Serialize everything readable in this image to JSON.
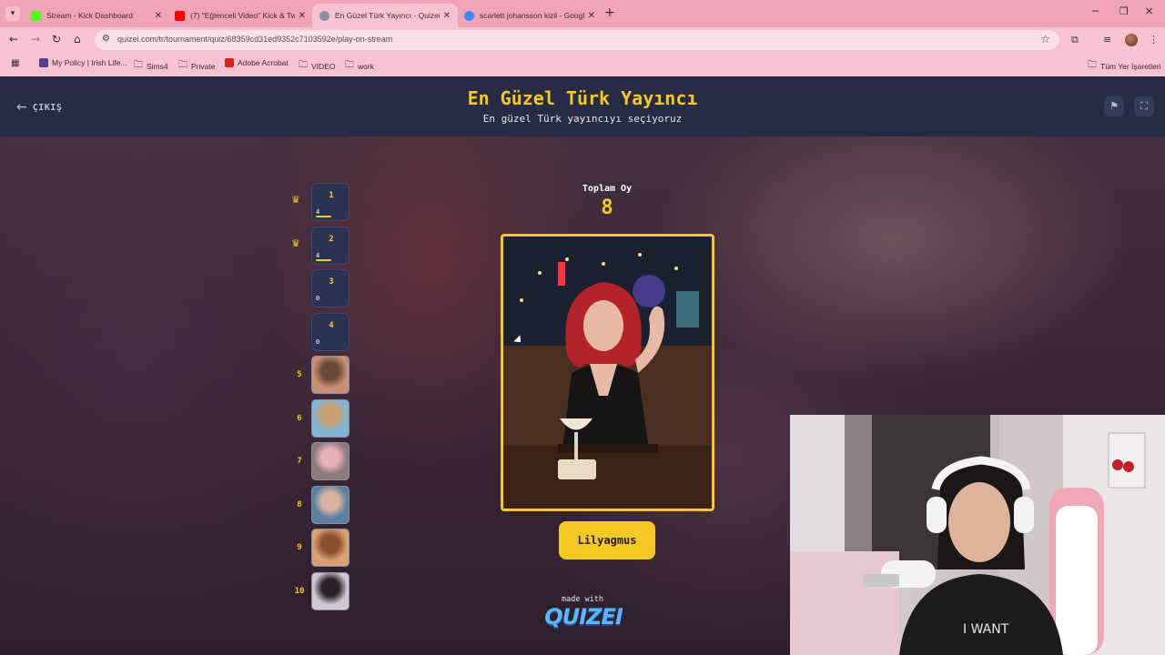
{
  "browser": {
    "tabs": [
      {
        "title": "Stream - Kick Dashboard",
        "favicon_color": "#53fc18"
      },
      {
        "title": "(7) \"Eğlenceli Video\" Kick & Tw",
        "favicon_color": "#ff0000"
      },
      {
        "title": "En Güzel Türk Yayıncı - Quizei",
        "favicon_color": "#8a8fa8"
      },
      {
        "title": "scarlett johansson kizil - Googl",
        "favicon_color": "#4285f4"
      }
    ],
    "active_tab": 2,
    "address": "quizei.com/tr/tournament/quiz/68359cd31ed9352c7103592e/play-on-stream",
    "bookmarks": [
      {
        "label": "My Policy | Irish Life...",
        "icon": "policy-icon"
      },
      {
        "label": "Sims4",
        "icon": "folder-icon"
      },
      {
        "label": "Private",
        "icon": "folder-icon"
      },
      {
        "label": "Adobe Acrobat",
        "icon": "acrobat-icon"
      },
      {
        "label": "VIDEO",
        "icon": "folder-icon"
      },
      {
        "label": "work",
        "icon": "folder-icon"
      }
    ],
    "all_bookmarks": "Tüm Yer İşaretleri"
  },
  "quiz": {
    "exit_label": "ÇIKIŞ",
    "title": "En Güzel Türk Yayıncı",
    "subtitle": "En güzel Türk yayıncıyı seçiyoruz",
    "total_votes_label": "Toplam Oy",
    "total_votes": "8",
    "current_name": "Lilyagmus",
    "made_with": "made with",
    "brand": "QUIZEI",
    "accent_color": "#f5c924"
  },
  "ranking": [
    {
      "rank": "1",
      "votes": "4",
      "share": 0.5,
      "crown": true,
      "revealed": false
    },
    {
      "rank": "2",
      "votes": "4",
      "share": 0.5,
      "crown": true,
      "revealed": false
    },
    {
      "rank": "3",
      "votes": "0",
      "share": 0,
      "crown": false,
      "revealed": false
    },
    {
      "rank": "4",
      "votes": "0",
      "share": 0,
      "crown": false,
      "revealed": false
    },
    {
      "rank": "5",
      "revealed": true
    },
    {
      "rank": "6",
      "revealed": true
    },
    {
      "rank": "7",
      "revealed": true
    },
    {
      "rank": "8",
      "revealed": true
    },
    {
      "rank": "9",
      "revealed": true
    },
    {
      "rank": "10",
      "revealed": true
    }
  ]
}
